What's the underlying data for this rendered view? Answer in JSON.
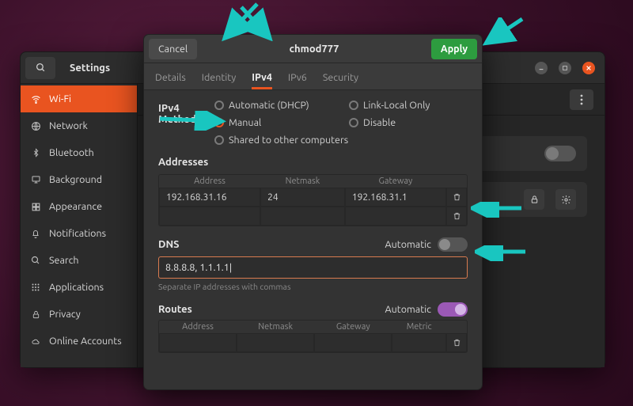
{
  "settings": {
    "title": "Settings",
    "sidebar": [
      {
        "label": "Wi-Fi",
        "icon": "wifi",
        "active": true
      },
      {
        "label": "Network",
        "icon": "network"
      },
      {
        "label": "Bluetooth",
        "icon": "bluetooth"
      },
      {
        "label": "Background",
        "icon": "display"
      },
      {
        "label": "Appearance",
        "icon": "appearance"
      },
      {
        "label": "Notifications",
        "icon": "bell"
      },
      {
        "label": "Search",
        "icon": "search"
      },
      {
        "label": "Applications",
        "icon": "apps"
      },
      {
        "label": "Privacy",
        "icon": "lock"
      },
      {
        "label": "Online Accounts",
        "icon": "cloud"
      }
    ]
  },
  "dialog": {
    "cancel_label": "Cancel",
    "apply_label": "Apply",
    "title": "chmod777",
    "tabs": [
      "Details",
      "Identity",
      "IPv4",
      "IPv6",
      "Security"
    ],
    "active_tab": "IPv4",
    "method": {
      "title": "IPv4 Method",
      "options": [
        "Automatic (DHCP)",
        "Link-Local Only",
        "Manual",
        "Disable",
        "Shared to other computers"
      ],
      "selected": "Manual"
    },
    "addresses": {
      "title": "Addresses",
      "headers": [
        "Address",
        "Netmask",
        "Gateway"
      ],
      "rows": [
        {
          "address": "192.168.31.16",
          "netmask": "24",
          "gateway": "192.168.31.1"
        },
        {
          "address": "",
          "netmask": "",
          "gateway": ""
        }
      ]
    },
    "dns": {
      "title": "DNS",
      "auto_label": "Automatic",
      "auto_on": false,
      "value": "8.8.8.8, 1.1.1.1|",
      "hint": "Separate IP addresses with commas"
    },
    "routes": {
      "title": "Routes",
      "auto_label": "Automatic",
      "auto_on": true,
      "headers": [
        "Address",
        "Netmask",
        "Gateway",
        "Metric"
      ]
    }
  }
}
